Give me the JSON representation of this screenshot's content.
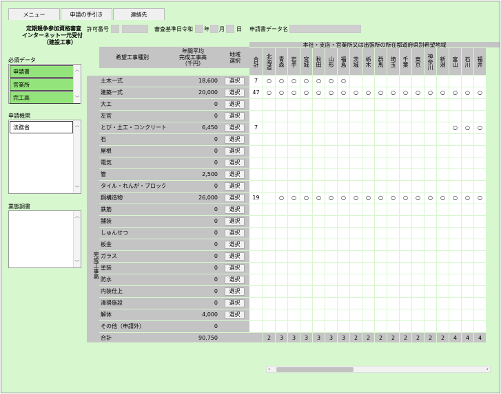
{
  "tabs": [
    "メニュー",
    "申請の手引き",
    "連絡先"
  ],
  "header": {
    "title_line1": "定期競争参加資格審査",
    "title_line2": "インターネット一元受付",
    "title_line3": "（建設工事）",
    "permit_label": "許可番号",
    "review_label": "審査基準日",
    "era": "令和",
    "year_unit": "年",
    "month_unit": "月",
    "day_unit": "日",
    "data_name_label": "申請書データ名"
  },
  "required_data": {
    "title": "必須データ",
    "items": [
      "申請書",
      "営業所",
      "完工高"
    ]
  },
  "agency": {
    "title": "申請機関",
    "items": [
      "法務省"
    ]
  },
  "survey": {
    "title": "業態調書"
  },
  "table": {
    "region_header": "本社・支店・営業所又は出張所の所在都道府県別希望地域",
    "col_type": "希望工事種別",
    "col_amount": "年間平均\n完成工事高\n（千円）",
    "col_region": "地域\n選択",
    "col_total": "合計",
    "side_label": "完成工事高",
    "select_label": "選択",
    "total_row_label": "合計",
    "total_row_amount": "90,750",
    "prefectures": [
      "北海道",
      "青森",
      "岩手",
      "宮城",
      "秋田",
      "山形",
      "福島",
      "茨城",
      "栃木",
      "群馬",
      "埼玉",
      "千葉",
      "東京",
      "神奈川",
      "新潟",
      "富山",
      "石川",
      "福井"
    ],
    "pref_totals": [
      "2",
      "3",
      "3",
      "3",
      "3",
      "3",
      "3",
      "2",
      "2",
      "2",
      "2",
      "2",
      "2",
      "2",
      "2",
      "4",
      "4",
      "4"
    ],
    "circle": "○",
    "rows": [
      {
        "name": "土木一式",
        "amount": "18,600",
        "count": "7",
        "marks": [
          1,
          1,
          1,
          1,
          1,
          1,
          1,
          0,
          0,
          0,
          0,
          0,
          0,
          0,
          0,
          0,
          0,
          0
        ]
      },
      {
        "name": "建築一式",
        "amount": "20,000",
        "count": "47",
        "marks": [
          1,
          1,
          1,
          1,
          1,
          1,
          1,
          1,
          1,
          1,
          1,
          1,
          1,
          1,
          1,
          1,
          1,
          1
        ]
      },
      {
        "name": "大工",
        "amount": "0",
        "count": "",
        "marks": []
      },
      {
        "name": "左官",
        "amount": "0",
        "count": "",
        "marks": []
      },
      {
        "name": "とび・土工・コンクリート",
        "amount": "6,450",
        "count": "7",
        "marks": [
          0,
          0,
          0,
          0,
          0,
          0,
          0,
          0,
          0,
          0,
          0,
          0,
          0,
          0,
          0,
          1,
          1,
          1
        ]
      },
      {
        "name": "石",
        "amount": "0",
        "count": "",
        "marks": []
      },
      {
        "name": "屋根",
        "amount": "0",
        "count": "",
        "marks": []
      },
      {
        "name": "電気",
        "amount": "0",
        "count": "",
        "marks": []
      },
      {
        "name": "管",
        "amount": "2,500",
        "count": "",
        "marks": []
      },
      {
        "name": "タイル・れんが・ブロック",
        "amount": "0",
        "count": "",
        "marks": []
      },
      {
        "name": "鋼構造物",
        "amount": "26,000",
        "count": "19",
        "marks": [
          0,
          1,
          1,
          1,
          1,
          1,
          1,
          1,
          1,
          1,
          1,
          1,
          1,
          1,
          1,
          1,
          1,
          1
        ]
      },
      {
        "name": "鉄筋",
        "amount": "0",
        "count": "",
        "marks": []
      },
      {
        "name": "舗装",
        "amount": "0",
        "count": "",
        "marks": []
      },
      {
        "name": "しゅんせつ",
        "amount": "0",
        "count": "",
        "marks": []
      },
      {
        "name": "板金",
        "amount": "0",
        "count": "",
        "marks": []
      },
      {
        "name": "ガラス",
        "amount": "0",
        "count": "",
        "marks": []
      },
      {
        "name": "塗装",
        "amount": "0",
        "count": "",
        "marks": []
      },
      {
        "name": "防水",
        "amount": "0",
        "count": "",
        "marks": []
      },
      {
        "name": "内装仕上",
        "amount": "0",
        "count": "",
        "marks": []
      },
      {
        "name": "清掃施設",
        "amount": "0",
        "count": "",
        "marks": []
      },
      {
        "name": "解体",
        "amount": "4,000",
        "count": "",
        "marks": []
      },
      {
        "name": "その他（申請外）",
        "amount": "0",
        "count": "",
        "marks": [],
        "no_select": true
      }
    ]
  }
}
